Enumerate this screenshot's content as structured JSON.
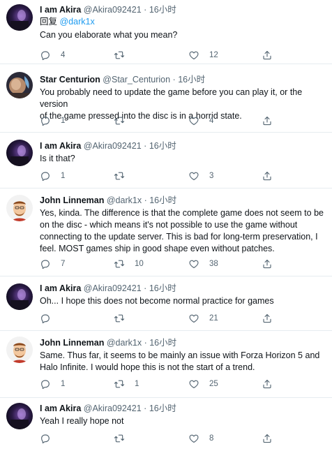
{
  "tweets": [
    {
      "name": "I am Akira",
      "handle": "@Akira092421",
      "dot": "·",
      "time": "16小时",
      "reply_prefix": "回复 ",
      "reply_to": "@dark1x",
      "lines": [
        "Can you elaborate what you mean?"
      ],
      "replies": "4",
      "retweets": "",
      "likes": "12",
      "avatar": "akira"
    },
    {
      "name": "Star Centurion",
      "handle": "@Star_Centurion",
      "dot": "·",
      "time": "16小时",
      "lines": [
        "You probably need to update the game before you can play it, or the version",
        "of the game pressed into the disc is in a horrid state."
      ],
      "replies": "1",
      "retweets": "",
      "likes": "4",
      "avatar": "star"
    },
    {
      "name": "I am Akira",
      "handle": "@Akira092421",
      "dot": "·",
      "time": "16小时",
      "lines": [
        "Is it that?"
      ],
      "replies": "1",
      "retweets": "",
      "likes": "3",
      "avatar": "akira"
    },
    {
      "name": "John Linneman",
      "handle": "@dark1x",
      "dot": "·",
      "time": "16小时",
      "lines": [
        "Yes, kinda. The difference is that the complete game does not seem to be",
        "on the disc - which means it's not possible to use the game without",
        "connecting to the update server. This is bad for long-term preservation, I",
        "feel. MOST games ship in good shape even without patches."
      ],
      "replies": "7",
      "retweets": "10",
      "likes": "38",
      "avatar": "john"
    },
    {
      "name": "I am Akira",
      "handle": "@Akira092421",
      "dot": "·",
      "time": "16小时",
      "lines": [
        "Oh... I hope this does not become normal practice for games"
      ],
      "replies": "",
      "retweets": "",
      "likes": "21",
      "avatar": "akira"
    },
    {
      "name": "John Linneman",
      "handle": "@dark1x",
      "dot": "·",
      "time": "16小时",
      "lines": [
        "Same. Thus far, it seems to be mainly an issue with Forza Horizon 5 and",
        "Halo Infinite. I would hope this is not the start of a trend."
      ],
      "replies": "1",
      "retweets": "1",
      "likes": "25",
      "avatar": "john"
    },
    {
      "name": "I am Akira",
      "handle": "@Akira092421",
      "dot": "·",
      "time": "16小时",
      "lines": [
        "Yeah I really hope not"
      ],
      "replies": "",
      "retweets": "",
      "likes": "8",
      "avatar": "akira"
    }
  ],
  "icons": {
    "reply": "reply-icon",
    "retweet": "retweet-icon",
    "like": "like-icon",
    "share": "share-icon"
  },
  "colors": {
    "text": "#0f1419",
    "secondary": "#536471",
    "link": "#1d9bf0",
    "divider": "#e6ecf0"
  }
}
